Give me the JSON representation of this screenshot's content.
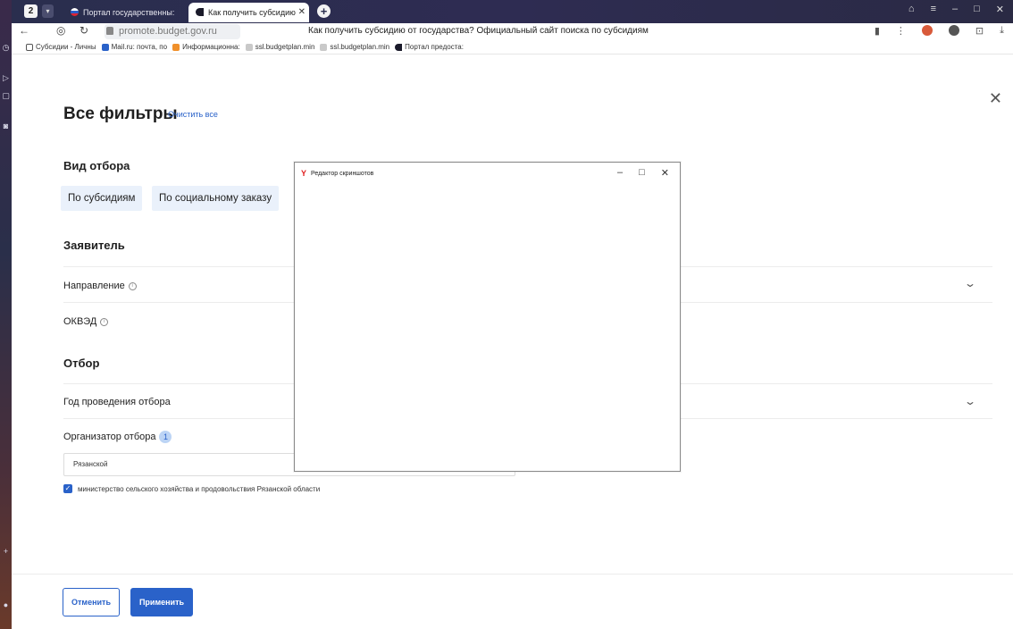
{
  "browser": {
    "tab_count": "2",
    "tabs": [
      {
        "label": "Портал государственны:"
      },
      {
        "label": "Как получить субсидию"
      }
    ],
    "url": "promote.budget.gov.ru",
    "page_title": "Как получить субсидию от государства? Официальный сайт поиска по субсидиям",
    "bookmarks": [
      {
        "label": "Субсидии - Личны"
      },
      {
        "label": "Mail.ru: почта, по"
      },
      {
        "label": "Информационна:"
      },
      {
        "label": "ssl.budgetplan.min"
      },
      {
        "label": "ssl.budgetplan.min"
      },
      {
        "label": "Портал предоста:"
      }
    ]
  },
  "filters": {
    "title": "Все фильтры",
    "clear_all": "Очистить все",
    "selection_type": {
      "heading": "Вид отбора",
      "options": [
        "По субсидиям",
        "По социальному заказу"
      ]
    },
    "applicant": {
      "heading": "Заявитель",
      "direction_label": "Направление",
      "okved_label": "ОКВЭД"
    },
    "selection": {
      "heading": "Отбор",
      "year_label": "Год проведения отбора",
      "organizer_label": "Организатор отбора",
      "organizer_count": "1",
      "search_value": "Рязанской",
      "checked_option": "министерство сельского хозяйства и продовольствия Рязанской области"
    },
    "cancel_label": "Отменить",
    "apply_label": "Применить"
  },
  "editor_window": {
    "title": "Редактор скриншотов"
  },
  "colors": {
    "accent": "#2a62c9",
    "chip_bg": "#eaf1fb",
    "tabbar_bg": "#2a2e4e"
  }
}
